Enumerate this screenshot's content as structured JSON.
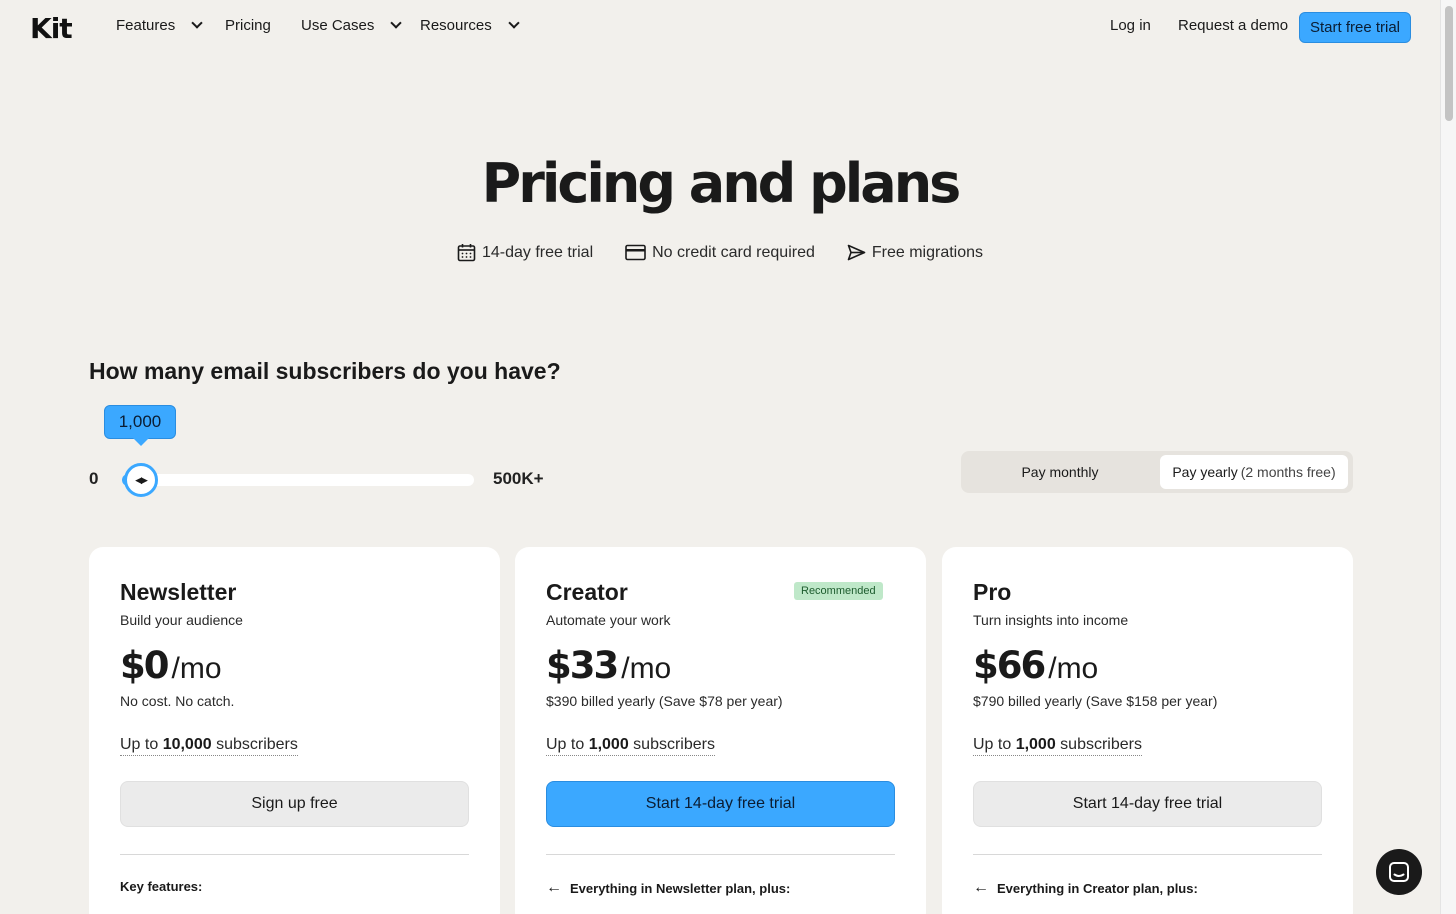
{
  "nav": {
    "logo": "Kit",
    "items": [
      {
        "label": "Features",
        "dropdown": true
      },
      {
        "label": "Pricing",
        "dropdown": false
      },
      {
        "label": "Use Cases",
        "dropdown": true
      },
      {
        "label": "Resources",
        "dropdown": true
      }
    ],
    "login": "Log in",
    "demo": "Request a demo",
    "trial": "Start free trial"
  },
  "hero": {
    "title": "Pricing and plans",
    "perks": [
      {
        "icon": "calendar-icon",
        "label": "14-day free trial"
      },
      {
        "icon": "credit-card-icon",
        "label": "No credit card required"
      },
      {
        "icon": "send-icon",
        "label": "Free migrations"
      }
    ]
  },
  "subscribers": {
    "question": "How many email subscribers do you have?",
    "value_label": "1,000",
    "min_label": "0",
    "max_label": "500K+",
    "slider_level": 0.002
  },
  "billing_toggle": {
    "monthly": "Pay monthly",
    "yearly": "Pay yearly",
    "yearly_note": "(2 months free)",
    "selected": "yearly"
  },
  "plans": [
    {
      "name": "Newsletter",
      "tagline": "Build your audience",
      "amount": "$0",
      "per": "/mo",
      "billing": "No cost. No catch.",
      "limit_prefix": "Up to ",
      "limit_value": "10,000",
      "limit_suffix": " subscribers",
      "cta": "Sign up free",
      "features_heading": "Key features:"
    },
    {
      "name": "Creator",
      "badge": "Recommended",
      "tagline": "Automate your work",
      "amount": "$33",
      "per": "/mo",
      "billing": "$390 billed yearly (Save $78 per year)",
      "limit_prefix": "Up to ",
      "limit_value": "1,000",
      "limit_suffix": " subscribers",
      "cta": "Start 14-day free trial",
      "features_heading": "Everything in Newsletter plan, plus:"
    },
    {
      "name": "Pro",
      "tagline": "Turn insights into income",
      "amount": "$66",
      "per": "/mo",
      "billing": "$790 billed yearly (Save $158 per year)",
      "limit_prefix": "Up to ",
      "limit_value": "1,000",
      "limit_suffix": " subscribers",
      "cta": "Start 14-day free trial",
      "features_heading": "Everything in Creator plan, plus:"
    }
  ],
  "colors": {
    "background": "#f2f0ec",
    "accent": "#3ba8ff",
    "badge_bg": "#bfe8c9",
    "card": "#ffffff"
  }
}
